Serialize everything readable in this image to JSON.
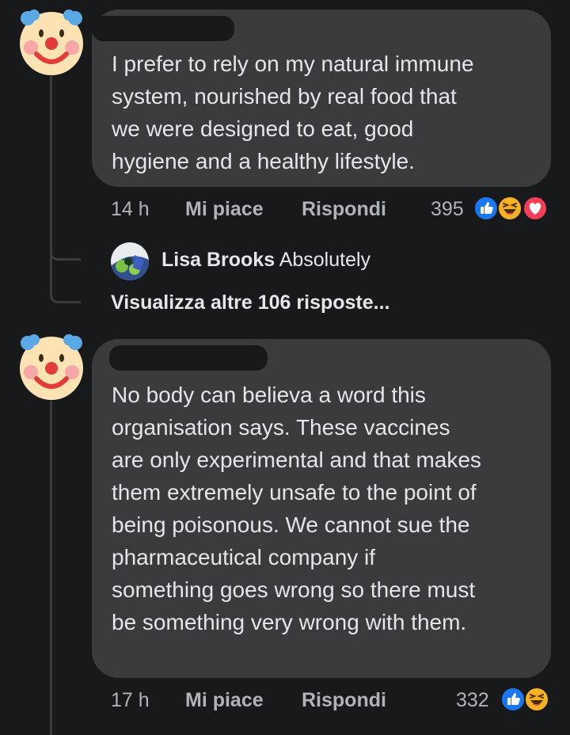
{
  "comments": [
    {
      "author": "",
      "text": "I prefer to rely on my natural immune\nsystem, nourished by real food that\nwe were designed to eat, good\nhygiene and a healthy lifestyle.",
      "time": "14 h",
      "like_label": "Mi piace",
      "reply_label": "Rispondi",
      "reaction_count": "395",
      "reactions": [
        "like-reaction-icon",
        "haha-reaction-icon",
        "love-reaction-icon"
      ],
      "reply_preview": {
        "author": "Lisa Brooks",
        "text": "Absolutely"
      },
      "more_replies_label": "Visualizza altre 106 risposte..."
    },
    {
      "author": "",
      "text": "No body can believa a word this\norganisation says. These vaccines\nare only experimental and that makes\nthem extremely unsafe to the point of\nbeing poisonous. We cannot sue the\npharmaceutical company if\nsomething goes wrong so there must\nbe something very wrong with them.",
      "time": "17 h",
      "like_label": "Mi piace",
      "reply_label": "Rispondi",
      "reaction_count": "332",
      "reactions": [
        "like-reaction-icon",
        "haha-reaction-icon"
      ]
    }
  ],
  "colors": {
    "background": "#18191a",
    "bubble": "#3a3b3c",
    "text": "#e4e6eb",
    "secondary_text": "#b0b3b8",
    "like_blue": "#1877f2",
    "love_red": "#f33e58",
    "haha_yellow": "#f7b125"
  }
}
